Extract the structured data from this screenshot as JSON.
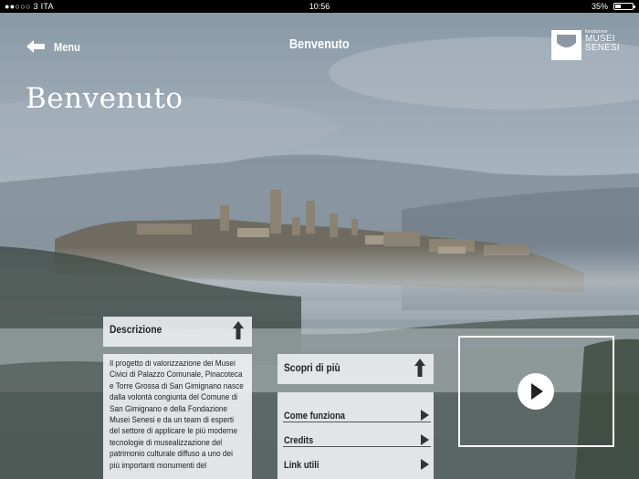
{
  "status_bar": {
    "carrier": "●●○○○ 3 ITA",
    "time": "10:56",
    "battery": "35%"
  },
  "nav": {
    "back_label": "Menu",
    "title": "Benvenuto"
  },
  "logo": {
    "line1": "fondazione",
    "line2": "MUSEI",
    "line3": "SENESI"
  },
  "hero": {
    "title": "Benvenuto"
  },
  "descrizione": {
    "title": "Descrizione",
    "body": "Il progetto di valorizzazione dei Musei Civici di Palazzo Comunale, Pinacoteca e Torre Grossa di San Gimignano nasce dalla volontà congiunta del Comune di San Gimignano e della Fondazione Musei Senesi e da un team di esperti del settore di applicare le più moderne tecnologie di musealizzazione del patrimonio culturale diffuso a uno dei più importanti monumenti del"
  },
  "scopri": {
    "title": "Scopri di più"
  },
  "links": [
    {
      "label": "Come funziona"
    },
    {
      "label": "Credits"
    },
    {
      "label": "Link utili"
    }
  ],
  "video": {
    "icon": "play-icon"
  },
  "colors": {
    "panel": "#e8ebee",
    "text": "#222222",
    "white": "#ffffff"
  }
}
